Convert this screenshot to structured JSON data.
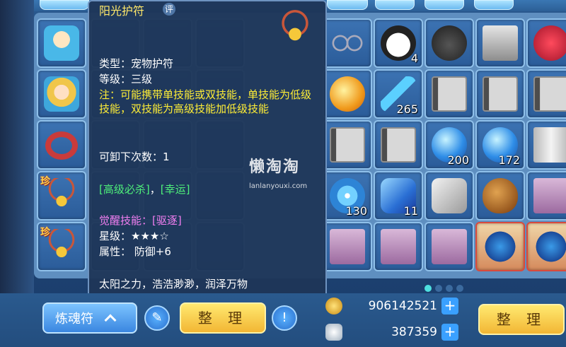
{
  "tooltip": {
    "title": "阳光护符",
    "rate_badge": "评",
    "type_line": "类型：宠物护符",
    "level_line": "等级：三级",
    "note": "注：可能携带单技能或双技能，单技能为低级技能，双技能为高级技能加低级技能",
    "unload_line": "可卸下次数：1",
    "skill_green_1": "[高级必杀]",
    "skill_sep": "，",
    "skill_green_2": "[幸运]",
    "awaken_label": "觉醒技能：",
    "awaken_skill": "[驱逐]",
    "star_line": "星级：★★★☆",
    "attr_line": "属性：  防御+6",
    "flavor": "太阳之力，浩浩渺渺，润泽万物"
  },
  "watermark": {
    "main": "懒淘淘",
    "sub": "lanlanyouxi.com"
  },
  "left_column": [
    {
      "icon": "mask-icon"
    },
    {
      "icon": "blonde-mask-icon"
    },
    {
      "icon": "collar-icon"
    },
    {
      "icon": "amulet-icon",
      "badge": "珍"
    },
    {
      "icon": "amulet-icon",
      "badge": "珍"
    }
  ],
  "grid": [
    [
      {
        "icon": "glasses-icon"
      },
      {
        "icon": "panda-icon",
        "qty": "4"
      },
      {
        "icon": "bag-icon"
      },
      {
        "icon": "chest-icon"
      },
      {
        "icon": "red-seal-icon"
      }
    ],
    [
      {
        "icon": "golden-orb-icon"
      },
      {
        "icon": "blue-horn-icon",
        "qty": "265"
      },
      {
        "icon": "book-icon"
      },
      {
        "icon": "book-icon"
      },
      {
        "icon": "book-icon"
      }
    ],
    [
      {
        "icon": "book-icon"
      },
      {
        "icon": "book-icon"
      },
      {
        "icon": "blue-orb-icon",
        "qty": "200"
      },
      {
        "icon": "blue-orb-icon",
        "qty": "172"
      },
      {
        "icon": "scroll-icon"
      }
    ],
    [
      {
        "icon": "swirl-orb-icon",
        "qty": "130"
      },
      {
        "icon": "crystal-icon",
        "qty": "11"
      },
      {
        "icon": "gray-item-icon"
      },
      {
        "icon": "seed-icon"
      },
      {
        "icon": "pet-card-icon"
      }
    ],
    [
      {
        "icon": "pet-card-icon"
      },
      {
        "icon": "pet-card-icon"
      },
      {
        "icon": "pet-card-icon"
      },
      {
        "icon": "feather-icon"
      },
      {
        "icon": "feather-icon"
      }
    ]
  ],
  "pagination": {
    "total": 4,
    "active": 0
  },
  "bottom": {
    "category_button": "炼魂符",
    "sort_left": "整 理",
    "sort_right": "整 理",
    "help_button": "!",
    "gold_value": "906142521",
    "silver_value": "387359",
    "plus_label": "+"
  },
  "colors": {
    "title": "#ffe86a",
    "note": "#ffee36",
    "green": "#4ef07a",
    "purple": "#f07ef0"
  }
}
